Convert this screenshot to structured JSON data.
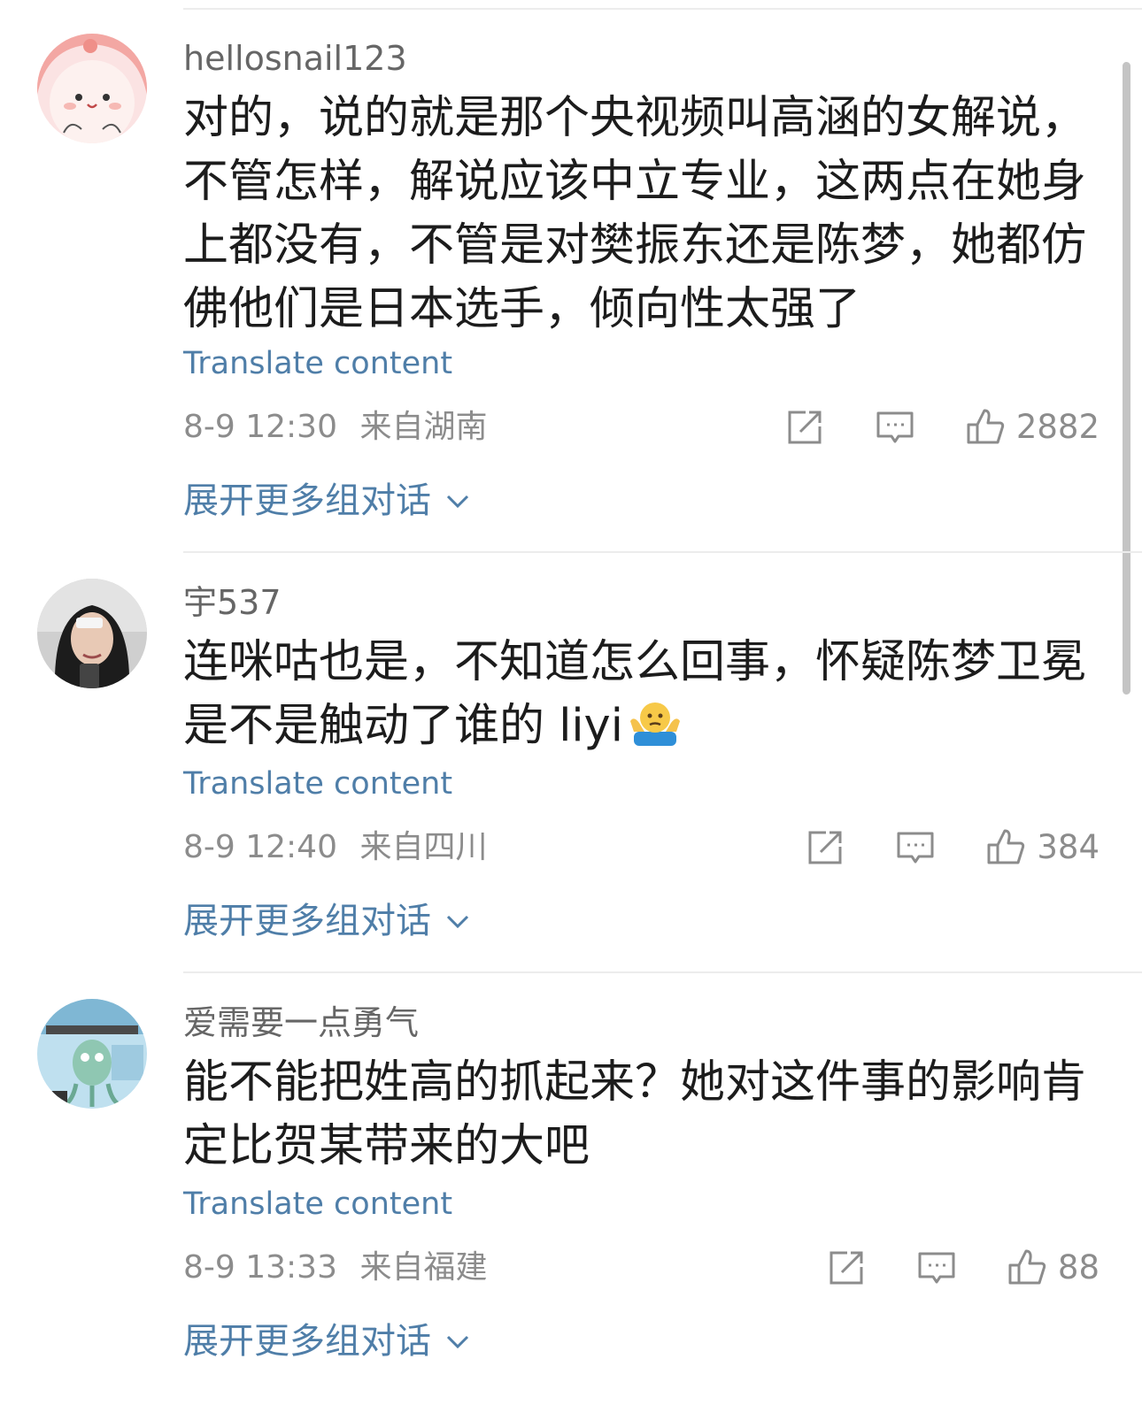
{
  "comments": [
    {
      "username": "hellosnail123",
      "text": "对的，说的就是那个央视频叫高涵的女解说，不管怎样，解说应该中立专业，这两点在她身上都没有，不管是对樊振东还是陈梦，她都仿佛他们是日本选手，倾向性太强了",
      "translate_label": "Translate content",
      "timestamp": "8-9 12:30",
      "location": "来自湖南",
      "like_count": "2882",
      "expand_label": "展开更多组对话",
      "avatar_icon": "cartoon-blob-avatar"
    },
    {
      "username": "宇537",
      "text": "连咪咕也是，不知道怎么回事，怀疑陈梦卫冕是不是触动了谁的 liyi",
      "emoji": "shrug-emoji",
      "translate_label": "Translate content",
      "timestamp": "8-9 12:40",
      "location": "来自四川",
      "like_count": "384",
      "expand_label": "展开更多组对话",
      "avatar_icon": "user-photo-avatar"
    },
    {
      "username": "爱需要一点勇气",
      "text": "能不能把姓高的抓起来？她对这件事的影响肯定比贺某带来的大吧",
      "translate_label": "Translate content",
      "timestamp": "8-9 13:33",
      "location": "来自福建",
      "like_count": "88",
      "expand_label": "展开更多组对话",
      "avatar_icon": "cartoon-squid-avatar"
    }
  ],
  "colors": {
    "link_blue": "#4f7ea8",
    "meta_gray": "#8c8c8c",
    "username_gray": "#666666",
    "divider": "#ececec"
  },
  "icons": [
    "share-icon",
    "comment-icon",
    "like-icon",
    "chevron-down-icon"
  ]
}
